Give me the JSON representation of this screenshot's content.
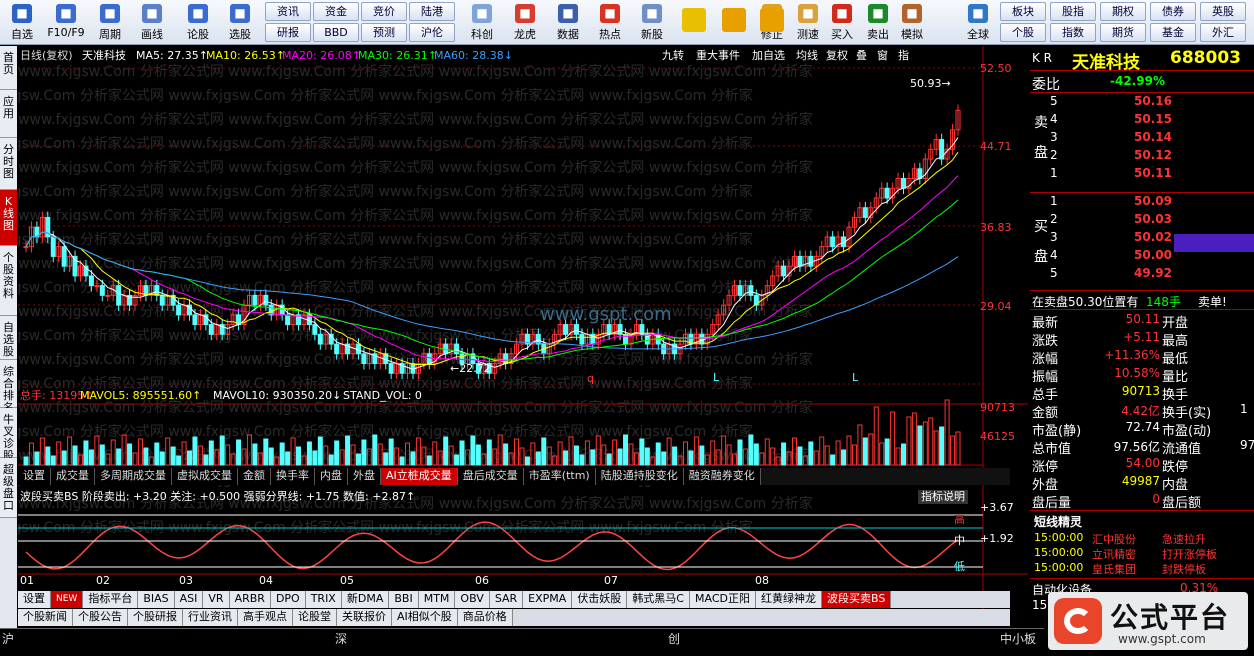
{
  "toolbar": {
    "items": [
      {
        "label": "自选",
        "icon": "star-icon",
        "color": "#2a62c5"
      },
      {
        "label": "F10/F9",
        "icon": "f10-icon",
        "color": "#3a6bd0"
      },
      {
        "label": "周期",
        "icon": "clock-icon",
        "color": "#3a6bd0"
      },
      {
        "label": "画线",
        "icon": "pencil-icon",
        "color": "#5a7fc8"
      },
      {
        "label": "论股",
        "icon": "discuss-icon",
        "color": "#3a6bd0"
      },
      {
        "label": "选股",
        "icon": "select-stock-icon",
        "color": "#3a6bd0"
      },
      {
        "label": "科创",
        "icon": "sci-tech-icon",
        "color": "#7fa4d9"
      },
      {
        "label": "龙虎",
        "icon": "dragon-tiger-icon",
        "color": "#d63c2f"
      },
      {
        "label": "数据",
        "icon": "data-icon",
        "color": "#3b5fab"
      },
      {
        "label": "热点",
        "icon": "hot-icon",
        "color": "#d83320"
      },
      {
        "label": "新股",
        "icon": "ipo-icon",
        "color": "#6f8fc7"
      },
      {
        "label": "修正",
        "icon": "undo-icon",
        "color": "#e2a21b"
      },
      {
        "label": "测速",
        "icon": "speed-test-icon",
        "color": "#d9a23a"
      },
      {
        "label": "买入",
        "icon": "buy-icon",
        "color": "#d12a1a"
      },
      {
        "label": "卖出",
        "icon": "sell-icon",
        "color": "#1d8a2a"
      },
      {
        "label": "模拟",
        "icon": "hammer-icon",
        "color": "#b0632b"
      },
      {
        "label": "全球",
        "icon": "globe-icon",
        "color": "#2d78c9"
      }
    ],
    "grid_left": {
      "row1": [
        "资讯",
        "资金",
        "竞价",
        "陆港"
      ],
      "row2": [
        "研报",
        "BBD",
        "预测",
        "沪伦"
      ]
    },
    "grid_right": {
      "row1": [
        "板块",
        "股指",
        "期权",
        "债券",
        "英股"
      ],
      "row2": [
        "个股",
        "指数",
        "期货",
        "基金",
        "外汇"
      ]
    }
  },
  "left_tabs": [
    "首页",
    "应用",
    "分时图",
    "K线图",
    "个股资料",
    "自选股",
    "综合排名",
    "牛叉诊股",
    "超级盘口"
  ],
  "header": {
    "period": "日线(复权)",
    "name": "天准科技",
    "ma5": "MA5: 27.35↑",
    "ma10": "MA10: 26.53↑",
    "ma20": "MA20: 26.08↑",
    "ma30": "MA30: 26.31↑",
    "ma60": "MA60: 28.38↓",
    "tools": [
      "九转",
      "重大事件",
      "加自选",
      "均线",
      "复权",
      "叠",
      "窗",
      "指"
    ]
  },
  "price_axis": [
    "52.50",
    "44.71",
    "36.83",
    "29.04"
  ],
  "annotations": {
    "high": "50.93→",
    "low": "←22.72",
    "q": "q",
    "l1": "L",
    "l2": "L",
    "watermark": "www.gspt.com"
  },
  "volume": {
    "label": "总手: 13195↑",
    "mavol5": "MAVOL5: 895551.60↑",
    "mavol10": "MAVOL10: 930350.20↓",
    "standvol": "STAND_VOL: 0",
    "axis": [
      "90713",
      "46125"
    ]
  },
  "vol_tabs": [
    "设置",
    "成交量",
    "多周期成交量",
    "虚拟成交量",
    "金额",
    "换手率",
    "内盘",
    "外盘",
    "AI立桩成交量",
    "盘后成交量",
    "市盈率(ttm)",
    "陆股通持股变化",
    "融资融券变化"
  ],
  "indicator": {
    "label": "波段买卖BS 阶段卖出: +3.20 关注: +0.500 强弱分界线: +1.75 数值: +2.87↑",
    "explain": "指标说明",
    "v1": "+3.67",
    "v2": "+1.92",
    "high": "高",
    "mid": "中",
    "low": "低"
  },
  "months": [
    "01",
    "02",
    "03",
    "04",
    "05",
    "06",
    "07",
    "08"
  ],
  "ind_tabs": {
    "new": "NEW",
    "items": [
      "设置",
      "指标平台",
      "BIAS",
      "ASI",
      "VR",
      "ARBR",
      "DPO",
      "TRIX",
      "新DMA",
      "BBI",
      "MTM",
      "OBV",
      "SAR",
      "EXPMA",
      "伏击妖股",
      "韩式黑马C",
      "MACD正阳",
      "红黄绿神龙",
      "波段买卖BS"
    ]
  },
  "news_tabs": [
    "个股新闻",
    "个股公告",
    "个股研报",
    "行业资讯",
    "高手观点",
    "论股堂",
    "关联报价",
    "AI相似个股",
    "商品价格"
  ],
  "status_bar": [
    "沪",
    "深",
    "创",
    "中小板"
  ],
  "quote": {
    "code": "688003",
    "name": "天准科技",
    "kr": "K R",
    "weibi_label": "委比",
    "weibi": "-42.99%",
    "sell_label": "卖盘",
    "buy_label": "买盘",
    "sell": [
      {
        "lvl": "5",
        "price": "50.16"
      },
      {
        "lvl": "4",
        "price": "50.15"
      },
      {
        "lvl": "3",
        "price": "50.14"
      },
      {
        "lvl": "2",
        "price": "50.12"
      },
      {
        "lvl": "1",
        "price": "50.11"
      }
    ],
    "buy": [
      {
        "lvl": "1",
        "price": "50.09"
      },
      {
        "lvl": "2",
        "price": "50.03"
      },
      {
        "lvl": "3",
        "price": "50.02"
      },
      {
        "lvl": "4",
        "price": "50.00"
      },
      {
        "lvl": "5",
        "price": "49.92"
      }
    ],
    "order_info": "在卖盘50.30位置有",
    "order_qty": "148手",
    "order_side": "卖单!",
    "stats": [
      [
        "最新",
        "50.11",
        "开盘",
        ""
      ],
      [
        "涨跌",
        "+5.11",
        "最高",
        ""
      ],
      [
        "涨幅",
        "+11.36%",
        "最低",
        ""
      ],
      [
        "振幅",
        "10.58%",
        "量比",
        ""
      ],
      [
        "总手",
        "90713",
        "换手",
        ""
      ],
      [
        "金额",
        "4.42亿",
        "换手(实)",
        "1"
      ],
      [
        "市盈(静)",
        "72.74",
        "市盈(动)",
        ""
      ],
      [
        "总市值",
        "97.56亿",
        "流通值",
        "97"
      ],
      [
        "涨停",
        "54.00",
        "跌停",
        ""
      ],
      [
        "外盘",
        "49987",
        "内盘",
        ""
      ],
      [
        "盘后量",
        "0",
        "盘后额",
        ""
      ]
    ],
    "jingling_title": "短线精灵",
    "jingling": [
      [
        "15:00:00",
        "汇中股份",
        "急速拉升"
      ],
      [
        "15:00:00",
        "立讯精密",
        "打开涨停板"
      ],
      [
        "15:00:00",
        "皇氏集团",
        "封跌停板"
      ]
    ],
    "auto_label": "自动化设备",
    "auto_pct": "0.31%",
    "bottom_num": "15"
  },
  "logo": {
    "text": "公式平台",
    "url": "www.gspt.com"
  },
  "colors": {
    "up": "#ff3333",
    "down": "#54ffff",
    "ma5": "#ffffff",
    "ma10": "#ffff00",
    "ma20": "#ff00ff",
    "ma30": "#00ff00",
    "ma60": "#3d9dff",
    "grid": "#8b0000"
  }
}
